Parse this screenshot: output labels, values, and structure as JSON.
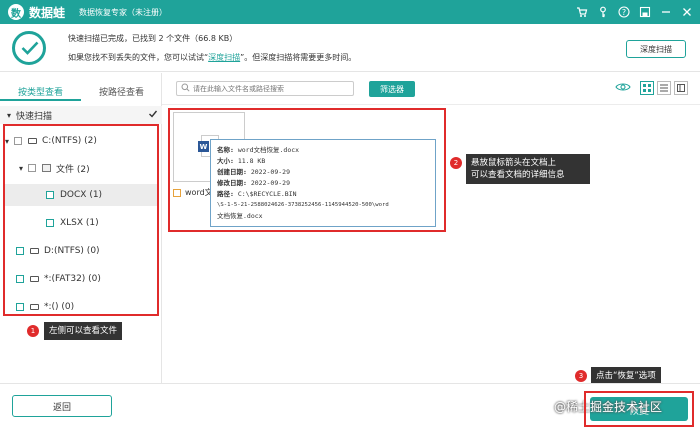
{
  "titlebar": {
    "logo_badge": "数",
    "brand": "数据蛙",
    "app_title": "数据恢复专家（未注册）",
    "controls": [
      "cart-icon",
      "key-icon",
      "help-icon",
      "save-icon",
      "minimize-icon",
      "close-icon"
    ]
  },
  "summary": {
    "line1": "快速扫描已完成，已找到 2 个文件（66.8 KB）",
    "line2_prefix": "如果您找不到丢失的文件，您可以试试“",
    "deep_link": "深度扫描",
    "line2_suffix": "”。但深度扫描将需要更多时间。",
    "deep_scan_button": "深度扫描"
  },
  "sidebar": {
    "tabs": [
      {
        "label": "按类型查看",
        "active": true
      },
      {
        "label": "按路径查看",
        "active": false
      }
    ],
    "fast_scan_label": "快速扫描",
    "tree": [
      {
        "label": "C:(NTFS) (2)",
        "kind": "drive"
      },
      {
        "label": "文件 (2)",
        "kind": "folder"
      },
      {
        "label": "DOCX (1)",
        "kind": "type"
      },
      {
        "label": "XLSX (1)",
        "kind": "type"
      },
      {
        "label": "D:(NTFS) (0)",
        "kind": "drive"
      },
      {
        "label": "*:(FAT32) (0)",
        "kind": "drive"
      },
      {
        "label": "*:() (0)",
        "kind": "drive"
      }
    ]
  },
  "toolbar": {
    "search_placeholder": "请在此输入文件名或路径搜索",
    "filter_button": "筛选器"
  },
  "file": {
    "name": "word文...",
    "tooltip": {
      "name_label": "名称:",
      "name_value": "word文档恢复.docx",
      "size_label": "大小:",
      "size_value": "11.8 KB",
      "created_label": "创建日期:",
      "created_value": "2022-09-29",
      "modified_label": "修改日期:",
      "modified_value": "2022-09-29",
      "path_label": "路径:",
      "path_value1": "C:\\$RECYCLE.BIN",
      "path_value2": "\\S-1-5-21-2588024626-3738252456-1145944520-500\\word",
      "path_value3": "文档恢复.docx"
    }
  },
  "annotations": {
    "c1_num": "1",
    "c1_text": "左侧可以查看文件",
    "c2_num": "2",
    "c2_line1": "悬放鼠标箭头在文档上",
    "c2_line2": "可以查看文档的详细信息",
    "c3_num": "3",
    "c3_text": "点击“恢复”选项"
  },
  "bottom": {
    "back_button": "返回",
    "recover_button": "恢复",
    "watermark": "@稀土掘金技术社区"
  },
  "colors": {
    "accent": "#1fa39a",
    "annotation_red": "#e02b2b"
  }
}
